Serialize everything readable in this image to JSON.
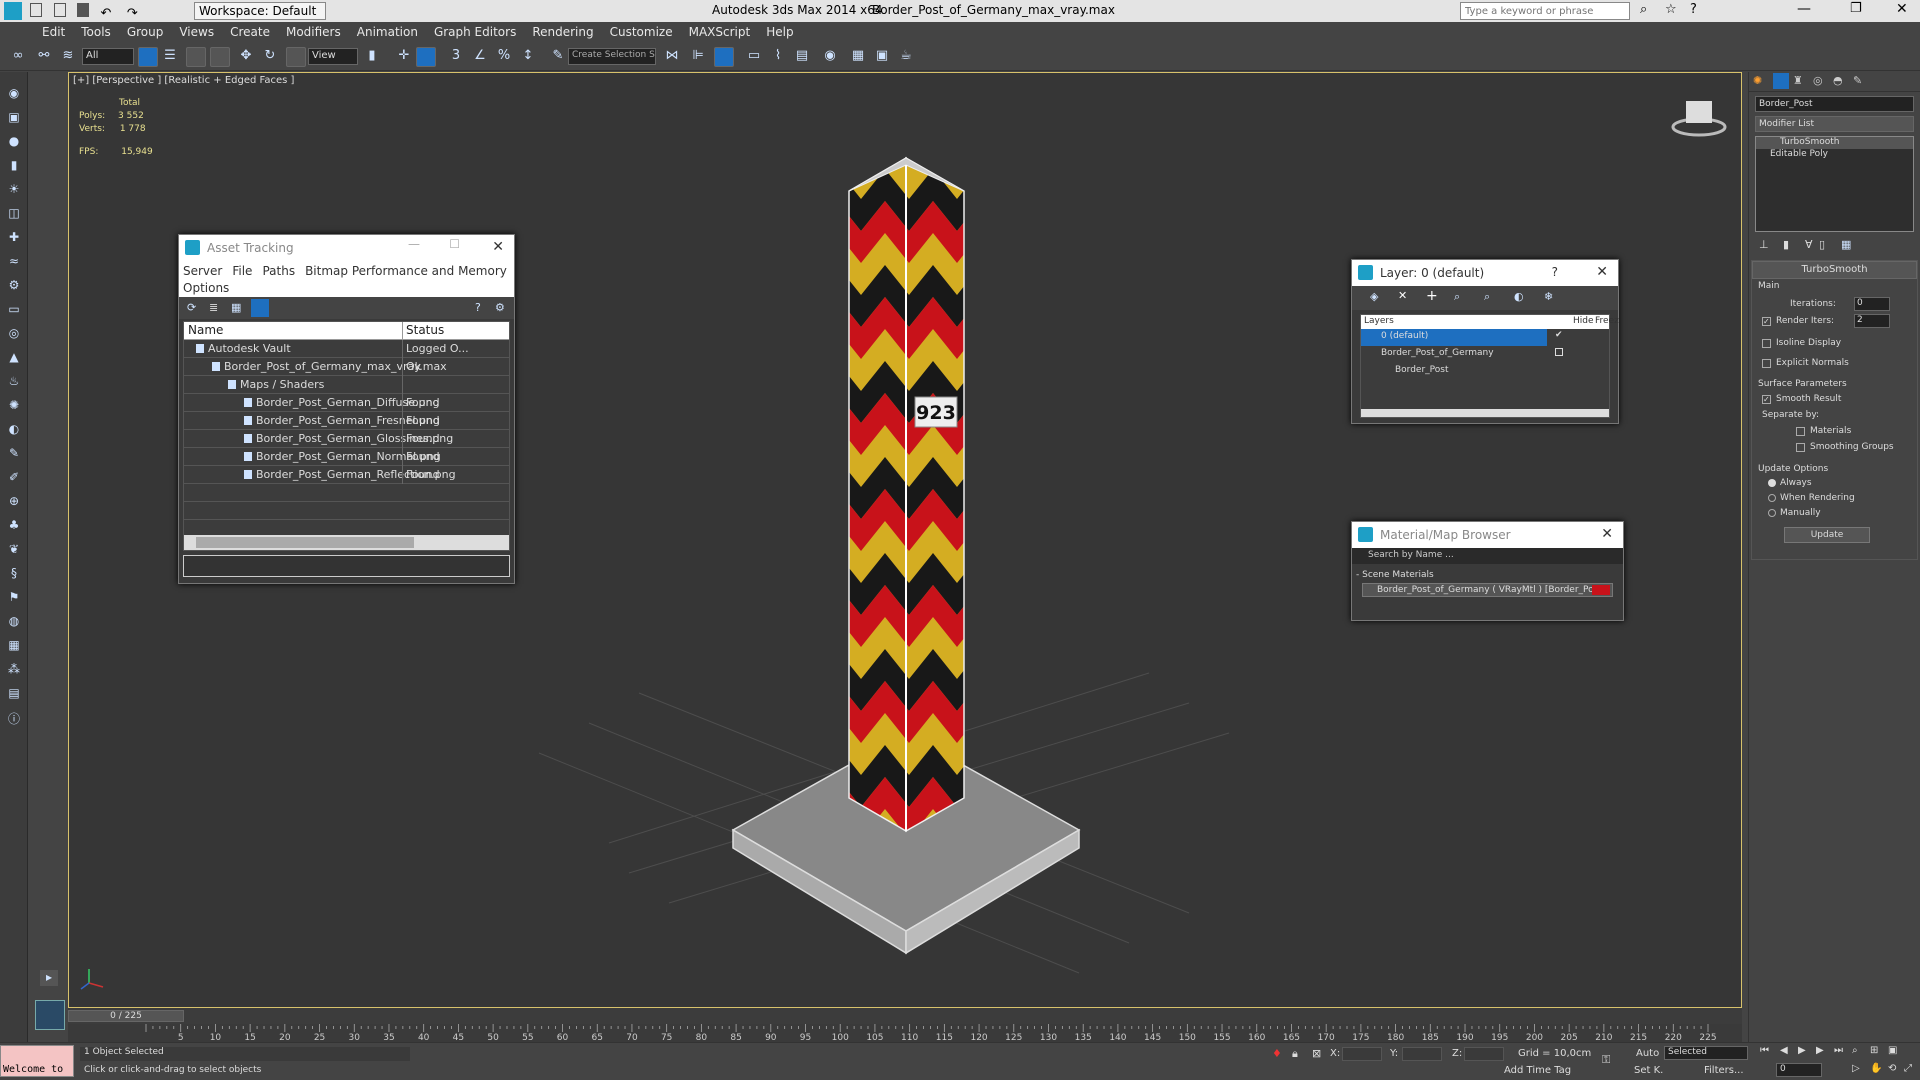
{
  "title": {
    "workspace": "Workspace: Default",
    "app": "Autodesk 3ds Max  2014 x64",
    "file": "Border_Post_of_Germany_max_vray.max",
    "search_placeholder": "Type a keyword or phrase"
  },
  "menu": [
    "Edit",
    "Tools",
    "Group",
    "Views",
    "Create",
    "Modifiers",
    "Animation",
    "Graph Editors",
    "Rendering",
    "Customize",
    "MAXScript",
    "Help"
  ],
  "toolbar": {
    "filter": "All",
    "refcoord": "View",
    "selset": "Create Selection Se"
  },
  "viewport": {
    "label": "[+] [Perspective ] [Realistic + Edged Faces ]",
    "stats": {
      "total_label": "Total",
      "polys_label": "Polys:",
      "polys": "3 552",
      "verts_label": "Verts:",
      "verts": "1 778",
      "fps_label": "FPS:",
      "fps": "15,949"
    },
    "post_number": "923"
  },
  "asset_tracking": {
    "title": "Asset Tracking",
    "menu": [
      "Server",
      "File",
      "Paths",
      "Bitmap Performance and Memory",
      "Options"
    ],
    "columns": [
      "Name",
      "Status"
    ],
    "rows": [
      {
        "name": "Autodesk Vault",
        "status": "Logged O...",
        "indent": 1
      },
      {
        "name": "Border_Post_of_Germany_max_vray.max",
        "status": "Ok",
        "indent": 2
      },
      {
        "name": "Maps / Shaders",
        "status": "",
        "indent": 3
      },
      {
        "name": "Border_Post_German_Diffuse.png",
        "status": "Found",
        "indent": 4
      },
      {
        "name": "Border_Post_German_Fresnel.png",
        "status": "Found",
        "indent": 4
      },
      {
        "name": "Border_Post_German_Glossines.png",
        "status": "Found",
        "indent": 4
      },
      {
        "name": "Border_Post_German_Normal.png",
        "status": "Found",
        "indent": 4
      },
      {
        "name": "Border_Post_German_Reflection.png",
        "status": "Found",
        "indent": 4
      }
    ]
  },
  "layer_window": {
    "title": "Layer: 0 (default)",
    "help": "?",
    "columns": [
      "Layers",
      "Hide",
      "Freez"
    ],
    "rows": [
      "0 (default)",
      "Border_Post_of_Germany",
      "Border_Post"
    ]
  },
  "material_browser": {
    "title": "Material/Map Browser",
    "search": "Search by Name ...",
    "section": "- Scene Materials",
    "item": "Border_Post_of_Germany ( VRayMtl ) [Border_Post]"
  },
  "command_panel": {
    "object_name": "Border_Post",
    "modifier_list": "Modifier List",
    "stack": [
      "TurboSmooth",
      "Editable Poly"
    ],
    "rollout_title": "TurboSmooth",
    "main": "Main",
    "iterations_label": "Iterations:",
    "iterations": "0",
    "render_iters_label": "Render Iters:",
    "render_iters": "2",
    "isoline": "Isoline Display",
    "explicit": "Explicit Normals",
    "surface": "Surface Parameters",
    "smooth": "Smooth Result",
    "separate": "Separate by:",
    "materials": "Materials",
    "smoothing": "Smoothing Groups",
    "update_opts": "Update Options",
    "always": "Always",
    "when_rendering": "When Rendering",
    "manually": "Manually",
    "update_btn": "Update"
  },
  "timeline": {
    "frame": "0 / 225",
    "ticks": [
      "5",
      "10",
      "15",
      "20",
      "25",
      "30",
      "35",
      "40",
      "45",
      "50",
      "55",
      "60",
      "65",
      "70",
      "75",
      "80",
      "85",
      "90",
      "95",
      "100",
      "105",
      "110",
      "115",
      "120",
      "125",
      "130",
      "135",
      "140",
      "145",
      "150",
      "155",
      "160",
      "165",
      "170",
      "175",
      "180",
      "185",
      "190",
      "195",
      "200",
      "205",
      "210",
      "215",
      "220",
      "225"
    ]
  },
  "status": {
    "welcome": "Welcome to",
    "selected": "1 Object Selected",
    "hint": "Click or click-and-drag to select objects",
    "x_label": "X:",
    "y_label": "Y:",
    "z_label": "Z:",
    "grid": "Grid = 10,0cm",
    "auto": "Auto",
    "selected_dd": "Selected",
    "setk": "Set K.",
    "filters": "Filters...",
    "add_time_tag": "Add Time Tag",
    "frame_field": "0"
  }
}
